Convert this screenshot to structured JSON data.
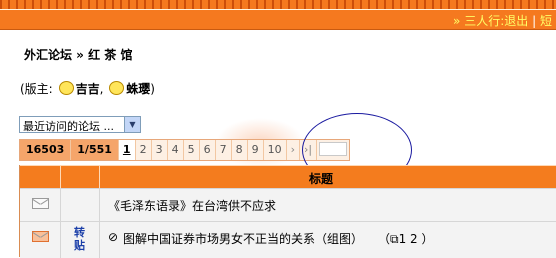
{
  "header": {
    "user_links": {
      "name": "三人行",
      "sep": ":",
      "logout": "退出",
      "divider": "|",
      "more": "短"
    }
  },
  "breadcrumb": "外汇论坛 » 红 茶 馆",
  "moderators": {
    "prefix": "(版主:",
    "names": [
      "吉吉",
      "蛛璎"
    ],
    "comma": ",",
    "suffix": ")"
  },
  "recent_forums_select": {
    "value": "最近访问的论坛 ..."
  },
  "pager": {
    "total_topics": "16503",
    "page_info": "1/551",
    "pages": [
      "1",
      "2",
      "3",
      "4",
      "5",
      "6",
      "7",
      "8",
      "9",
      "10"
    ],
    "next": "›",
    "last": "›|"
  },
  "table": {
    "header_title": "标题",
    "rows": [
      {
        "subject": "《毛泽东语录》在台湾供不应求",
        "tag": ""
      },
      {
        "subject": "图解中国证券市场男女不正当的关系（组图）",
        "tag": "转贴",
        "pages": "（",
        "page_nums": "1 2 ）"
      }
    ]
  }
}
